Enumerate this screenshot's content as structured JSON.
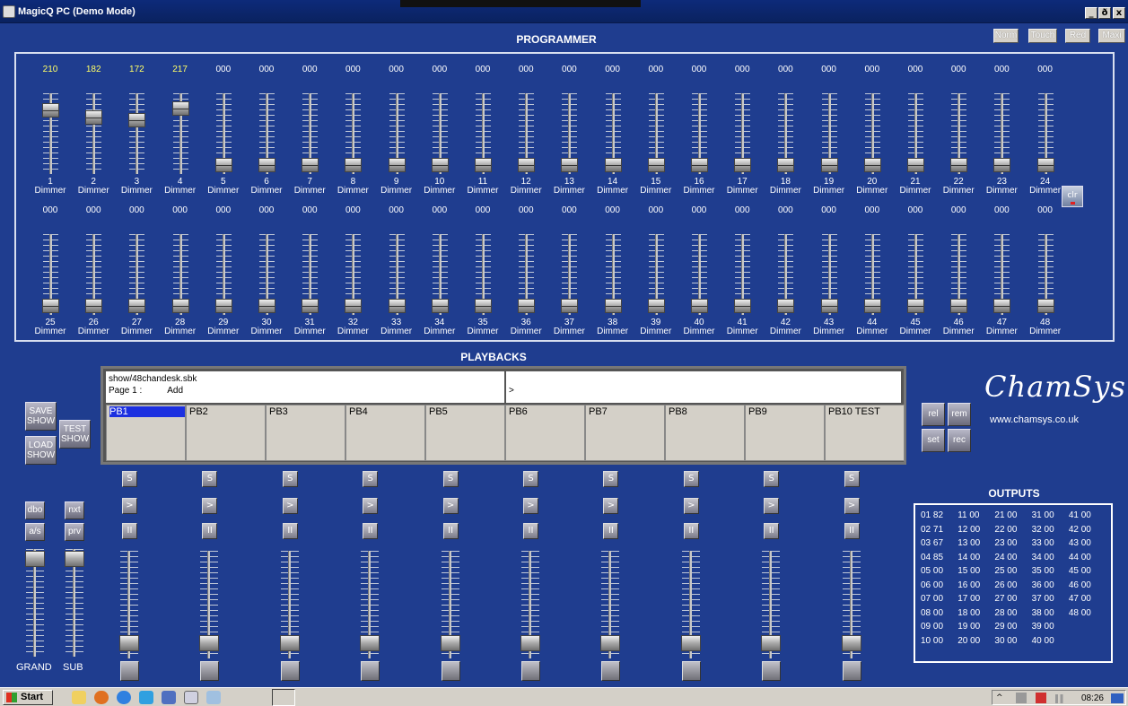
{
  "window": {
    "title": "MagicQ PC (Demo Mode)",
    "min": "_",
    "max": "ð",
    "close": "x"
  },
  "modes": [
    "Norm",
    "Touch",
    "Red",
    "Maxi"
  ],
  "programmer": {
    "title": "PROGRAMMER",
    "clear_label": "clr",
    "faders": [
      {
        "num": "1",
        "name": "Dimmer",
        "value": "210",
        "level": 0.82
      },
      {
        "num": "2",
        "name": "Dimmer",
        "value": "182",
        "level": 0.71
      },
      {
        "num": "3",
        "name": "Dimmer",
        "value": "172",
        "level": 0.67
      },
      {
        "num": "4",
        "name": "Dimmer",
        "value": "217",
        "level": 0.85
      },
      {
        "num": "5",
        "name": "Dimmer",
        "value": "000",
        "level": 0
      },
      {
        "num": "6",
        "name": "Dimmer",
        "value": "000",
        "level": 0
      },
      {
        "num": "7",
        "name": "Dimmer",
        "value": "000",
        "level": 0
      },
      {
        "num": "8",
        "name": "Dimmer",
        "value": "000",
        "level": 0
      },
      {
        "num": "9",
        "name": "Dimmer",
        "value": "000",
        "level": 0
      },
      {
        "num": "10",
        "name": "Dimmer",
        "value": "000",
        "level": 0
      },
      {
        "num": "11",
        "name": "Dimmer",
        "value": "000",
        "level": 0
      },
      {
        "num": "12",
        "name": "Dimmer",
        "value": "000",
        "level": 0
      },
      {
        "num": "13",
        "name": "Dimmer",
        "value": "000",
        "level": 0
      },
      {
        "num": "14",
        "name": "Dimmer",
        "value": "000",
        "level": 0
      },
      {
        "num": "15",
        "name": "Dimmer",
        "value": "000",
        "level": 0
      },
      {
        "num": "16",
        "name": "Dimmer",
        "value": "000",
        "level": 0
      },
      {
        "num": "17",
        "name": "Dimmer",
        "value": "000",
        "level": 0
      },
      {
        "num": "18",
        "name": "Dimmer",
        "value": "000",
        "level": 0
      },
      {
        "num": "19",
        "name": "Dimmer",
        "value": "000",
        "level": 0
      },
      {
        "num": "20",
        "name": "Dimmer",
        "value": "000",
        "level": 0
      },
      {
        "num": "21",
        "name": "Dimmer",
        "value": "000",
        "level": 0
      },
      {
        "num": "22",
        "name": "Dimmer",
        "value": "000",
        "level": 0
      },
      {
        "num": "23",
        "name": "Dimmer",
        "value": "000",
        "level": 0
      },
      {
        "num": "24",
        "name": "Dimmer",
        "value": "000",
        "level": 0
      },
      {
        "num": "25",
        "name": "Dimmer",
        "value": "000",
        "level": 0
      },
      {
        "num": "26",
        "name": "Dimmer",
        "value": "000",
        "level": 0
      },
      {
        "num": "27",
        "name": "Dimmer",
        "value": "000",
        "level": 0
      },
      {
        "num": "28",
        "name": "Dimmer",
        "value": "000",
        "level": 0
      },
      {
        "num": "29",
        "name": "Dimmer",
        "value": "000",
        "level": 0
      },
      {
        "num": "30",
        "name": "Dimmer",
        "value": "000",
        "level": 0
      },
      {
        "num": "31",
        "name": "Dimmer",
        "value": "000",
        "level": 0
      },
      {
        "num": "32",
        "name": "Dimmer",
        "value": "000",
        "level": 0
      },
      {
        "num": "33",
        "name": "Dimmer",
        "value": "000",
        "level": 0
      },
      {
        "num": "34",
        "name": "Dimmer",
        "value": "000",
        "level": 0
      },
      {
        "num": "35",
        "name": "Dimmer",
        "value": "000",
        "level": 0
      },
      {
        "num": "36",
        "name": "Dimmer",
        "value": "000",
        "level": 0
      },
      {
        "num": "37",
        "name": "Dimmer",
        "value": "000",
        "level": 0
      },
      {
        "num": "38",
        "name": "Dimmer",
        "value": "000",
        "level": 0
      },
      {
        "num": "39",
        "name": "Dimmer",
        "value": "000",
        "level": 0
      },
      {
        "num": "40",
        "name": "Dimmer",
        "value": "000",
        "level": 0
      },
      {
        "num": "41",
        "name": "Dimmer",
        "value": "000",
        "level": 0
      },
      {
        "num": "42",
        "name": "Dimmer",
        "value": "000",
        "level": 0
      },
      {
        "num": "43",
        "name": "Dimmer",
        "value": "000",
        "level": 0
      },
      {
        "num": "44",
        "name": "Dimmer",
        "value": "000",
        "level": 0
      },
      {
        "num": "45",
        "name": "Dimmer",
        "value": "000",
        "level": 0
      },
      {
        "num": "46",
        "name": "Dimmer",
        "value": "000",
        "level": 0
      },
      {
        "num": "47",
        "name": "Dimmer",
        "value": "000",
        "level": 0
      },
      {
        "num": "48",
        "name": "Dimmer",
        "value": "000",
        "level": 0
      }
    ]
  },
  "playbacks": {
    "title": "PLAYBACKS",
    "show_file": "show/48chandesk.sbk",
    "page_label": "Page 1 :",
    "page_mode": "Add",
    "command_line": ">",
    "names": [
      "PB1",
      "PB2",
      "PB3",
      "PB4",
      "PB5",
      "PB6",
      "PB7",
      "PB8",
      "PB9",
      "PB10 TEST"
    ],
    "select_label": "S",
    "go_label": ">",
    "pause_label": "II",
    "save_show": "SAVE SHOW",
    "test_show": "TEST SHOW",
    "load_show": "LOAD SHOW",
    "rel": "rel",
    "rem": "rem",
    "set": "set",
    "rec": "rec",
    "dbo": "dbo",
    "nxt": "nxt",
    "as": "a/s",
    "prv": "prv",
    "grand": "GRAND",
    "sub": "SUB"
  },
  "brand": {
    "logo": "ChamSys",
    "url": "www.chamsys.co.uk"
  },
  "outputs": {
    "title": "OUTPUTS",
    "rows": [
      [
        "01 82",
        "11 00",
        "21 00",
        "31 00",
        "41 00"
      ],
      [
        "02 71",
        "12 00",
        "22 00",
        "32 00",
        "42 00"
      ],
      [
        "03 67",
        "13 00",
        "23 00",
        "33 00",
        "43 00"
      ],
      [
        "04 85",
        "14 00",
        "24 00",
        "34 00",
        "44 00"
      ],
      [
        "05 00",
        "15 00",
        "25 00",
        "35 00",
        "45 00"
      ],
      [
        "06 00",
        "16 00",
        "26 00",
        "36 00",
        "46 00"
      ],
      [
        "07 00",
        "17 00",
        "27 00",
        "37 00",
        "47 00"
      ],
      [
        "08 00",
        "18 00",
        "28 00",
        "38 00",
        "48 00"
      ],
      [
        "09 00",
        "19 00",
        "29 00",
        "39 00",
        ""
      ],
      [
        "10 00",
        "20 00",
        "30 00",
        "40 00",
        ""
      ]
    ]
  },
  "taskbar": {
    "start": "Start",
    "clock": "08:26"
  },
  "colors": {
    "background": "#1f3d8f",
    "value_lit": "#ffff66",
    "selection": "#1c30e0"
  }
}
